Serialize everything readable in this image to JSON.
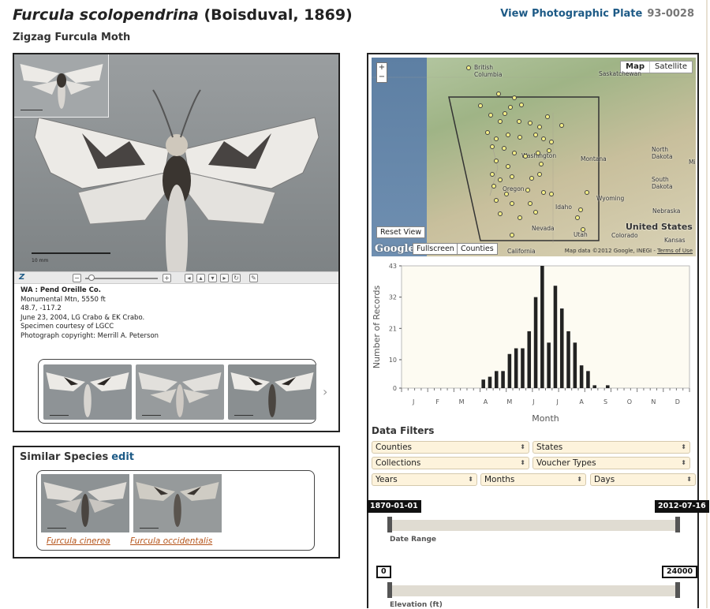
{
  "header": {
    "species": "Furcula scolopendrina",
    "author": " (Boisduval, 1869)",
    "common_name": "Zigzag Furcula Moth",
    "plate_link": "View Photographic Plate",
    "plate_number": "93-0028"
  },
  "specimen": {
    "scale_label": "10 mm",
    "location": "WA : Pend Oreille Co.",
    "site": "Monumental Mtn, 5550 ft",
    "coords": "48.7, -117.2",
    "collected": "June 23, 2004, LG Crabo & EK Crabo.",
    "courtesy": "Specimen courtesy of LGCC",
    "copyright": "Photograph copyright: Merrill A. Peterson"
  },
  "zoom_controls": {
    "logo": "Z",
    "minus": "−",
    "plus": "+",
    "buttons": [
      "◂",
      "▴",
      "▾",
      "▸",
      "↻",
      "✎"
    ]
  },
  "similar": {
    "title": "Similar Species",
    "edit": "edit",
    "species": [
      "Furcula cinerea",
      "Furcula occidentalis"
    ]
  },
  "map": {
    "zoom_in": "+",
    "zoom_out": "−",
    "type_map": "Map",
    "type_satellite": "Satellite",
    "labels": {
      "bc": "British\nColumbia",
      "sask": "Saskatchewan",
      "montana": "Montana",
      "nd": "North\nDakota",
      "sd": "South\nDakota",
      "wyoming": "Wyoming",
      "nebraska": "Nebraska",
      "us": "United States",
      "nevada": "Nevada",
      "utah": "Utah",
      "colorado": "Colorado",
      "kansas": "Kansas",
      "idaho": "Idaho",
      "oregon": "Oregon",
      "washington": "Washington",
      "california": "California",
      "mi": "Mir"
    },
    "reset": "Reset View",
    "fullscreen": "Fullscreen",
    "counties": "Counties",
    "google": "Google",
    "credit": "Map data ©2012 Google, INEGI - ",
    "terms": "Terms of Use"
  },
  "chart_data": {
    "type": "bar",
    "ylabel": "Number of Records",
    "xlabel": "Month",
    "ylim": [
      0,
      43
    ],
    "yticks": [
      0,
      10,
      21,
      32,
      43
    ],
    "month_labels": [
      "J",
      "F",
      "M",
      "A",
      "M",
      "J",
      "J",
      "A",
      "S",
      "O",
      "N",
      "D"
    ],
    "bars_per_month": 4,
    "values": [
      0,
      0,
      0,
      0,
      0,
      0,
      0,
      0,
      0,
      0,
      0,
      0,
      3,
      4,
      6,
      6,
      12,
      14,
      14,
      20,
      32,
      43,
      16,
      36,
      28,
      20,
      16,
      8,
      6,
      1,
      0,
      1,
      0,
      0,
      0,
      0,
      0,
      0,
      0,
      0,
      0,
      0,
      0,
      0
    ]
  },
  "filters": {
    "title": "Data Filters",
    "counties": "Counties",
    "states": "States",
    "collections": "Collections",
    "voucher": "Voucher Types",
    "years": "Years",
    "months": "Months",
    "days": "Days",
    "arrow": "⬍"
  },
  "date_range": {
    "start": "1870-01-01",
    "end": "2012-07-16",
    "label": "Date Range"
  },
  "elevation": {
    "min": "0",
    "max": "24000",
    "label": "Elevation (ft)"
  }
}
